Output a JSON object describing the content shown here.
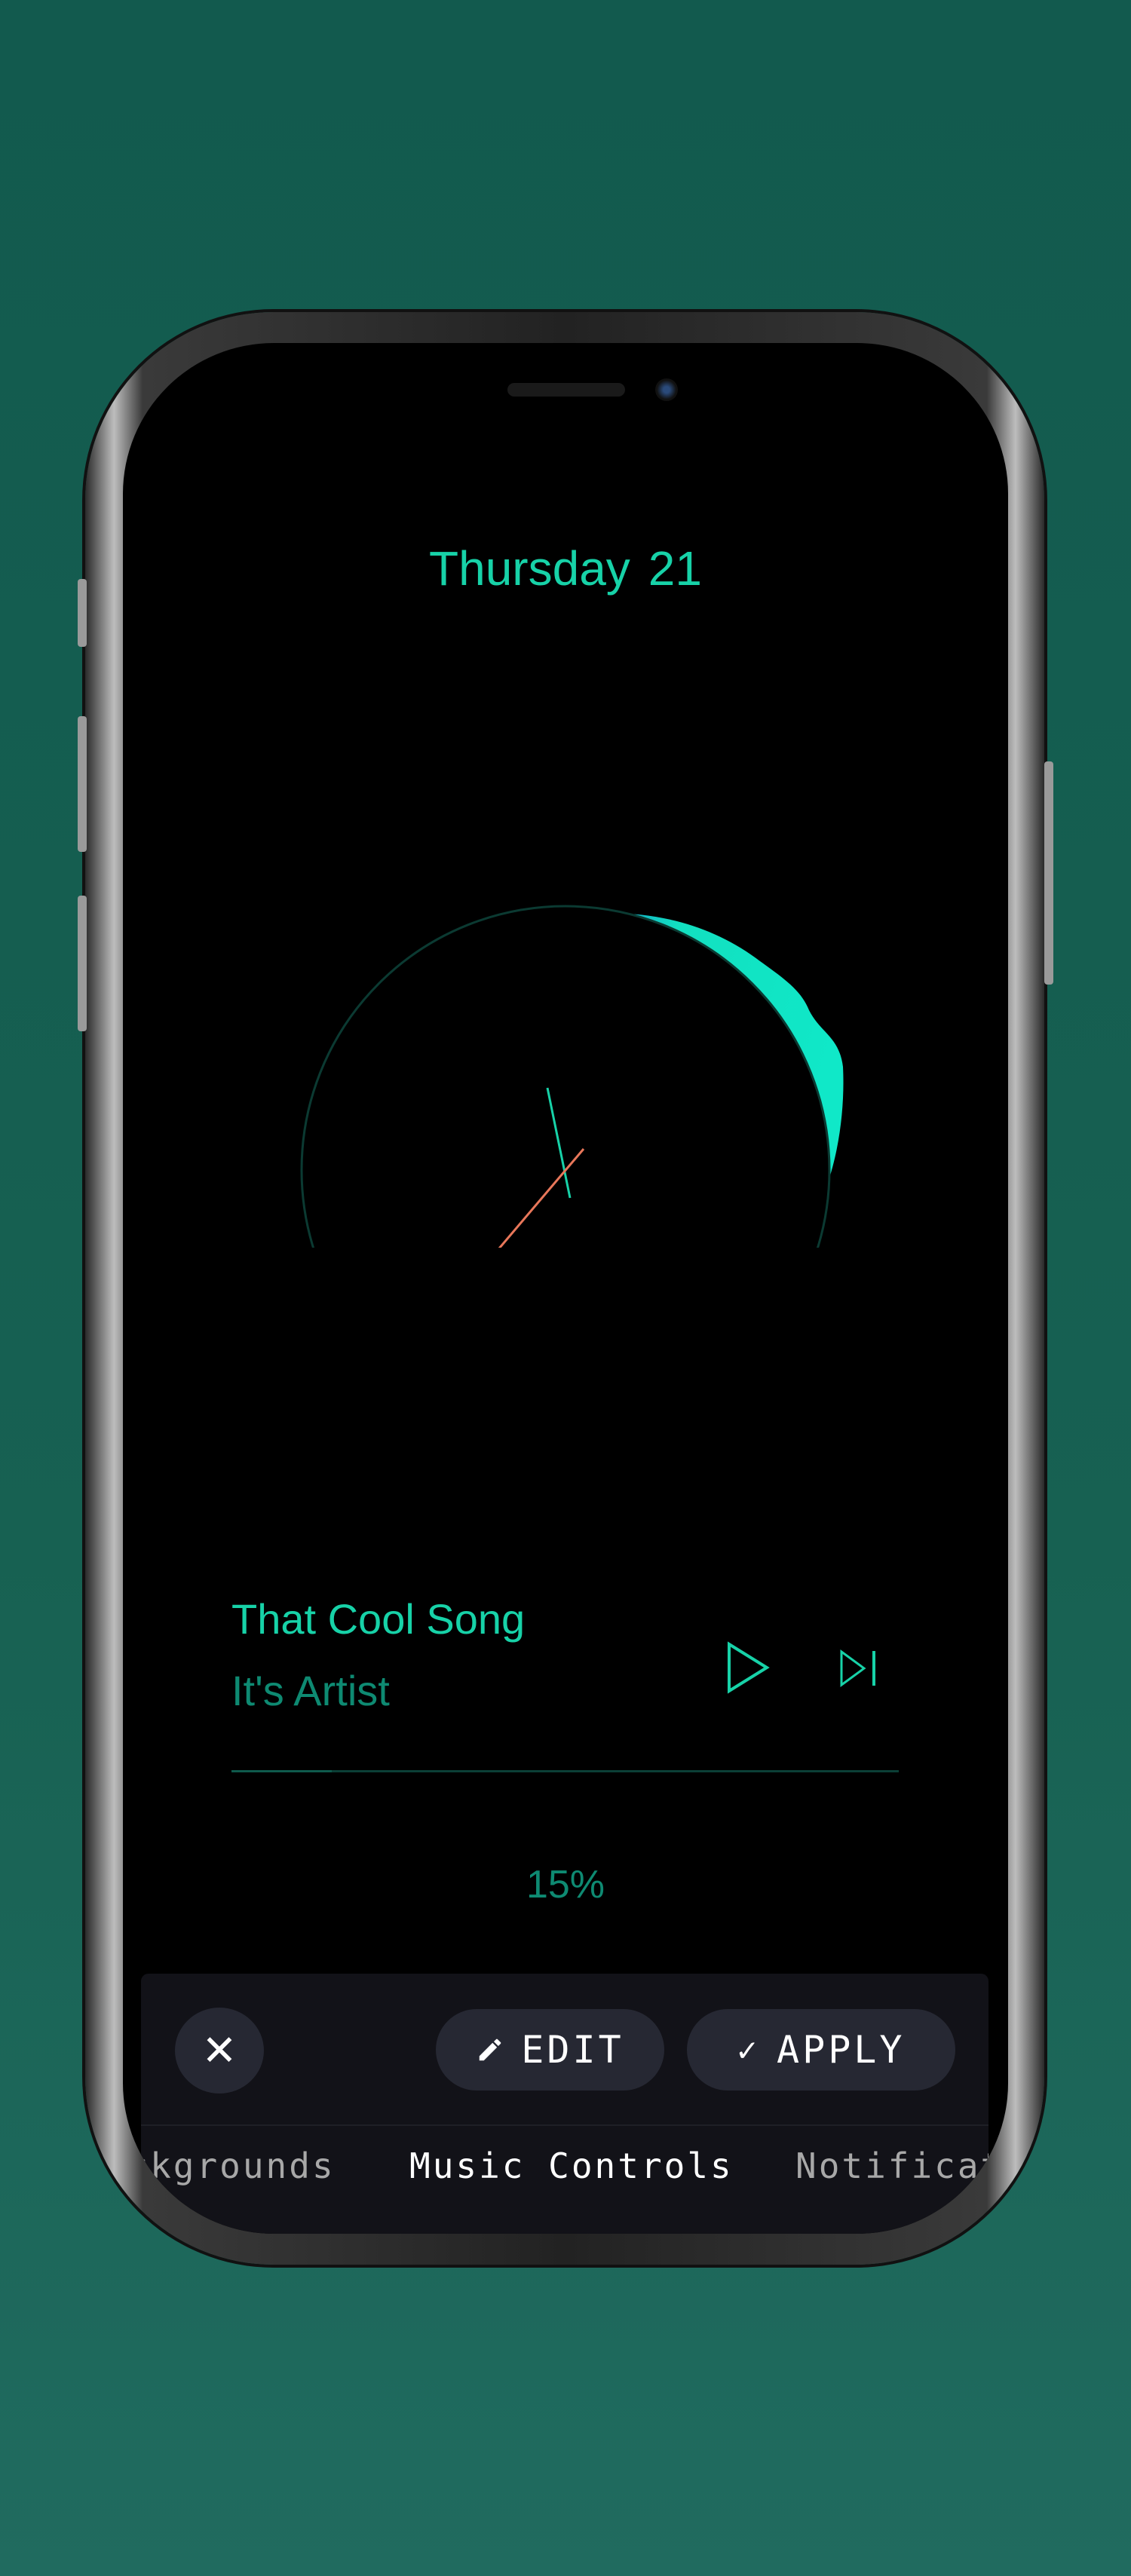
{
  "lockscreen": {
    "day": "Thursday",
    "date_number": "21"
  },
  "music": {
    "title": "That Cool Song",
    "artist": "It's Artist",
    "progress_percent": 15,
    "progress_label": "15%",
    "play_icon": "play-outline-icon",
    "next_icon": "skip-next-outline-icon"
  },
  "colors": {
    "accent": "#17d2a8",
    "accent_dim": "#0e8a72",
    "ring_blue": "#1060e0",
    "hour_hand": "#e8775a",
    "panel": "#121218",
    "button": "#262833"
  },
  "toolbar": {
    "close_icon": "close-icon",
    "edit_label": "EDIT",
    "apply_label": "APPLY",
    "edit_icon": "pencil-icon",
    "apply_icon": "check-icon"
  },
  "tabs": [
    {
      "label": "Backgrounds",
      "visible_label": "kgrounds"
    },
    {
      "label": "Music Controls",
      "active": true
    },
    {
      "label": "Notificat"
    }
  ]
}
